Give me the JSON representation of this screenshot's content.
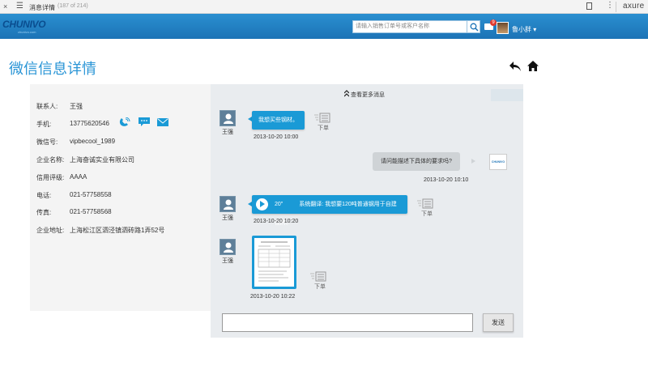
{
  "browser": {
    "close_glyph": "×",
    "menu_glyph": "☰",
    "tab_title": "消息详情",
    "page_count": "(187 of 214)",
    "more_glyph": "⋮",
    "brand": "axure"
  },
  "header": {
    "logo": "CHUNIVO",
    "logo_sub": "chunivo.com",
    "search_placeholder": "请输入销售订单号或客户名称",
    "mail_badge": "9",
    "username": "鲁小胖 ▾"
  },
  "page": {
    "title": "微信信息详情"
  },
  "customer": {
    "fields": [
      {
        "label": "联系人:",
        "value": "王强"
      },
      {
        "label": "手机:",
        "value": "13775620546"
      },
      {
        "label": "微信号:",
        "value": "vipbecool_1989"
      },
      {
        "label": "企业名称:",
        "value": "上海奋诚实业有限公司"
      },
      {
        "label": "信用评级:",
        "value": "AAAA"
      },
      {
        "label": "电话:",
        "value": "021-57758558"
      },
      {
        "label": "传真:",
        "value": "021-57758568"
      },
      {
        "label": "企业地址:",
        "value": "上海松江区泗泾镇泗砖路1弄52号"
      }
    ]
  },
  "chat": {
    "more_messages": "查看更多消息",
    "customer_name": "王强",
    "staff_logo": "CHUNIVO",
    "order_label": "下单",
    "messages": [
      {
        "text": "我想买些钢材。",
        "time": "2013-10-20 10:00"
      },
      {
        "text": "请问能描述下具体的要求吗?",
        "time": "2013-10-20 10:10"
      },
      {
        "duration": "20\"",
        "text": "系统翻译: 我想要120吨普通钢用于自建住房。",
        "time": "2013-10-20 10:20"
      },
      {
        "time": "2013-10-20 10:22"
      }
    ],
    "send_label": "发送"
  },
  "colors": {
    "header_blue": "#1f7fc1",
    "accent_blue": "#1a9ad6",
    "title_blue": "#2a95d6"
  }
}
